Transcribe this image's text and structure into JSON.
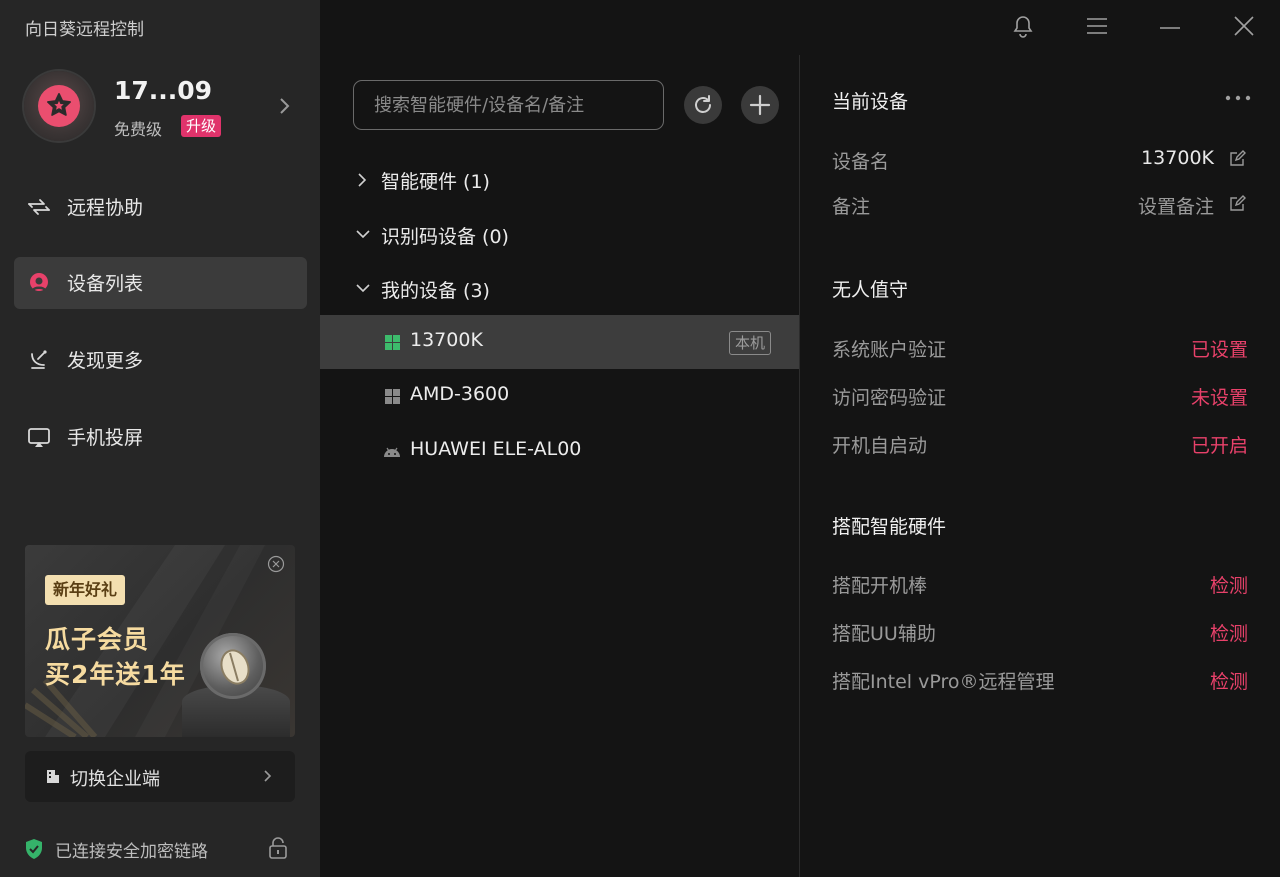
{
  "app": {
    "title": "向日葵远程控制"
  },
  "user": {
    "name": "17...09",
    "tier": "免费级",
    "upgrade": "升级"
  },
  "nav": [
    {
      "label": "远程协助",
      "icon": "remote-assist-icon"
    },
    {
      "label": "设备列表",
      "icon": "device-list-icon",
      "active": true
    },
    {
      "label": "发现更多",
      "icon": "discover-icon"
    },
    {
      "label": "手机投屏",
      "icon": "screen-cast-icon"
    }
  ],
  "promo": {
    "tag": "新年好礼",
    "line1": "瓜子会员",
    "line2": "买2年送1年"
  },
  "switch_enterprise": {
    "label": "切换企业端"
  },
  "security": {
    "text": "已连接安全加密链路"
  },
  "search": {
    "placeholder": "搜索智能硬件/设备名/备注"
  },
  "groups": [
    {
      "label": "智能硬件 (1)",
      "expanded": false
    },
    {
      "label": "识别码设备 (0)",
      "expanded": true
    },
    {
      "label": "我的设备 (3)",
      "expanded": true
    }
  ],
  "devices": [
    {
      "name": "13700K",
      "icon": "windows-icon",
      "badge": "本机",
      "selected": true
    },
    {
      "name": "AMD-3600",
      "icon": "windows-icon"
    },
    {
      "name": "HUAWEI ELE-AL00",
      "icon": "android-icon"
    }
  ],
  "details": {
    "current_title": "当前设备",
    "device_name_label": "设备名",
    "device_name_value": "13700K",
    "remark_label": "备注",
    "remark_value": "设置备注",
    "unattended_title": "无人值守",
    "sys_account_label": "系统账户验证",
    "sys_account_value": "已设置",
    "access_pwd_label": "访问密码验证",
    "access_pwd_value": "未设置",
    "autostart_label": "开机自启动",
    "autostart_value": "已开启",
    "hardware_title": "搭配智能硬件",
    "boot_stick_label": "搭配开机棒",
    "boot_stick_value": "检测",
    "uu_label": "搭配UU辅助",
    "uu_value": "检测",
    "vpro_label": "搭配Intel vPro®远程管理",
    "vpro_value": "检测"
  },
  "colors": {
    "accent": "#e8416a",
    "sidebar": "#262626",
    "background": "#141414",
    "windows_green": "#3dbb6c"
  }
}
